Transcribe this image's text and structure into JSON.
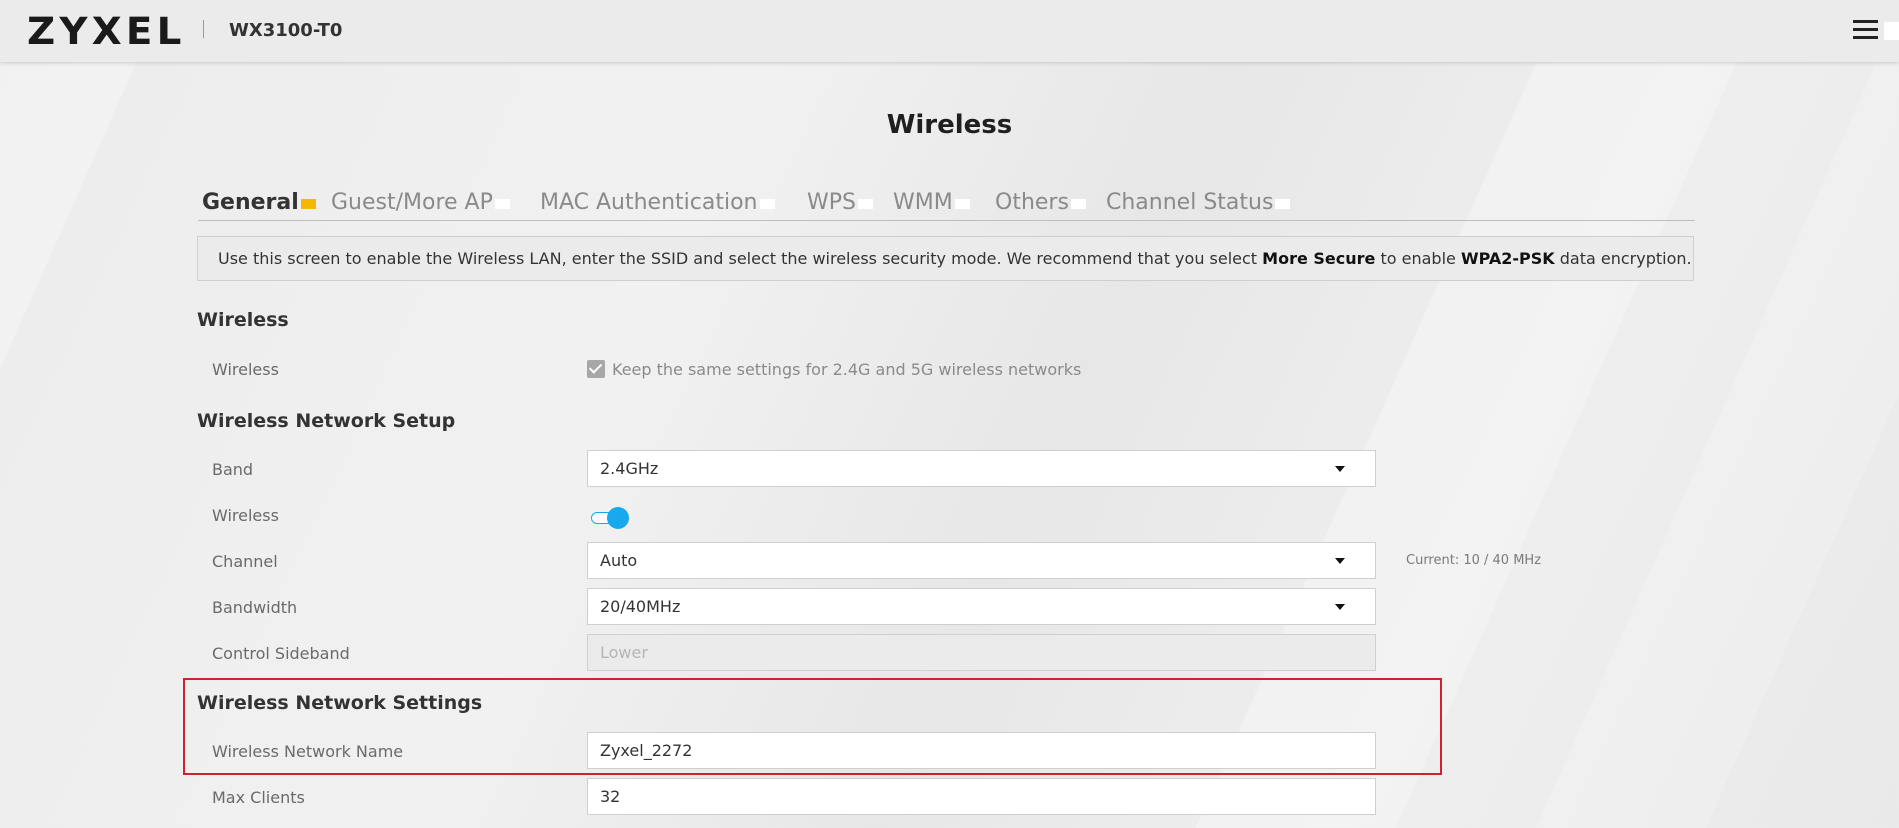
{
  "header": {
    "logo": "ZYXEL",
    "model": "WX3100-T0"
  },
  "page": {
    "title": "Wireless"
  },
  "tabs": [
    {
      "label": "General",
      "active": true
    },
    {
      "label": "Guest/More AP",
      "active": false
    },
    {
      "label": "MAC Authentication",
      "active": false
    },
    {
      "label": "WPS",
      "active": false
    },
    {
      "label": "WMM",
      "active": false
    },
    {
      "label": "Others",
      "active": false
    },
    {
      "label": "Channel Status",
      "active": false
    }
  ],
  "info": {
    "part1": "Use this screen to enable the Wireless LAN, enter the SSID and select the wireless security mode. We recommend that you select ",
    "bold1": "More Secure",
    "part2": " to enable ",
    "bold2": "WPA2-PSK",
    "part3": " data encryption."
  },
  "wireless_section": {
    "title": "Wireless",
    "wireless_label": "Wireless",
    "keep_same_label": "Keep the same settings for 2.4G and 5G wireless networks",
    "keep_same_checked": true
  },
  "network_setup": {
    "title": "Wireless Network Setup",
    "band_label": "Band",
    "band_value": "2.4GHz",
    "wireless_label": "Wireless",
    "wireless_enabled": true,
    "channel_label": "Channel",
    "channel_value": "Auto",
    "channel_current": "Current: 10 / 40 MHz",
    "bandwidth_label": "Bandwidth",
    "bandwidth_value": "20/40MHz",
    "sideband_label": "Control Sideband",
    "sideband_value": "Lower"
  },
  "network_settings": {
    "title": "Wireless Network Settings",
    "name_label": "Wireless Network Name",
    "name_value": "Zyxel_2272",
    "max_clients_label": "Max Clients",
    "max_clients_value": "32"
  },
  "colors": {
    "accent": "#f5b800",
    "toggle": "#17a8ee",
    "highlight_box": "#d4202c"
  }
}
